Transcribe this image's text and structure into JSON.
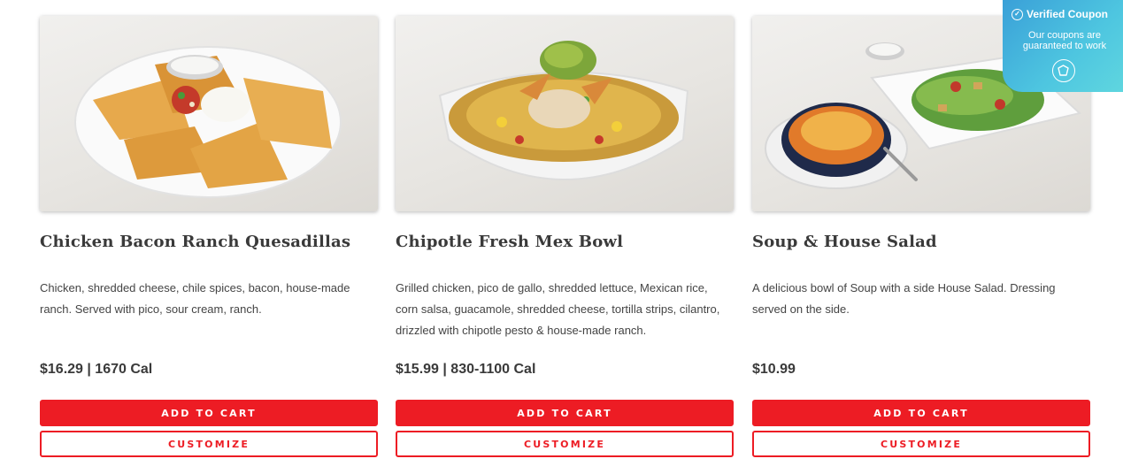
{
  "products": [
    {
      "name": "Chicken Bacon Ranch Quesadillas",
      "description": "Chicken, shredded cheese, chile spices, bacon, house-made ranch. Served with pico, sour cream, ranch.",
      "price": "$16.29 | 1670 Cal",
      "add_label": "ADD TO CART",
      "customize_label": "CUSTOMIZE"
    },
    {
      "name": "Chipotle Fresh Mex Bowl",
      "description": "Grilled chicken, pico de gallo, shredded lettuce, Mexican rice, corn salsa, guacamole, shredded cheese, tortilla strips, cilantro, drizzled with chipotle pesto & house-made ranch.",
      "price": "$15.99 | 830-1100 Cal",
      "add_label": "ADD TO CART",
      "customize_label": "CUSTOMIZE"
    },
    {
      "name": "Soup & House Salad",
      "description": "A delicious bowl of Soup with a side House Salad. Dressing served on the side.",
      "price": "$10.99",
      "add_label": "ADD TO CART",
      "customize_label": "CUSTOMIZE"
    }
  ],
  "coupon_badge": {
    "title": "Verified Coupon",
    "subtitle": "Our coupons are guaranteed to work",
    "icon": "shield-icon"
  },
  "colors": {
    "accent_red": "#ed1c24",
    "text_dark": "#3a3a3a",
    "badge_blue": "#3aa0d8",
    "badge_teal": "#5fd6df"
  }
}
